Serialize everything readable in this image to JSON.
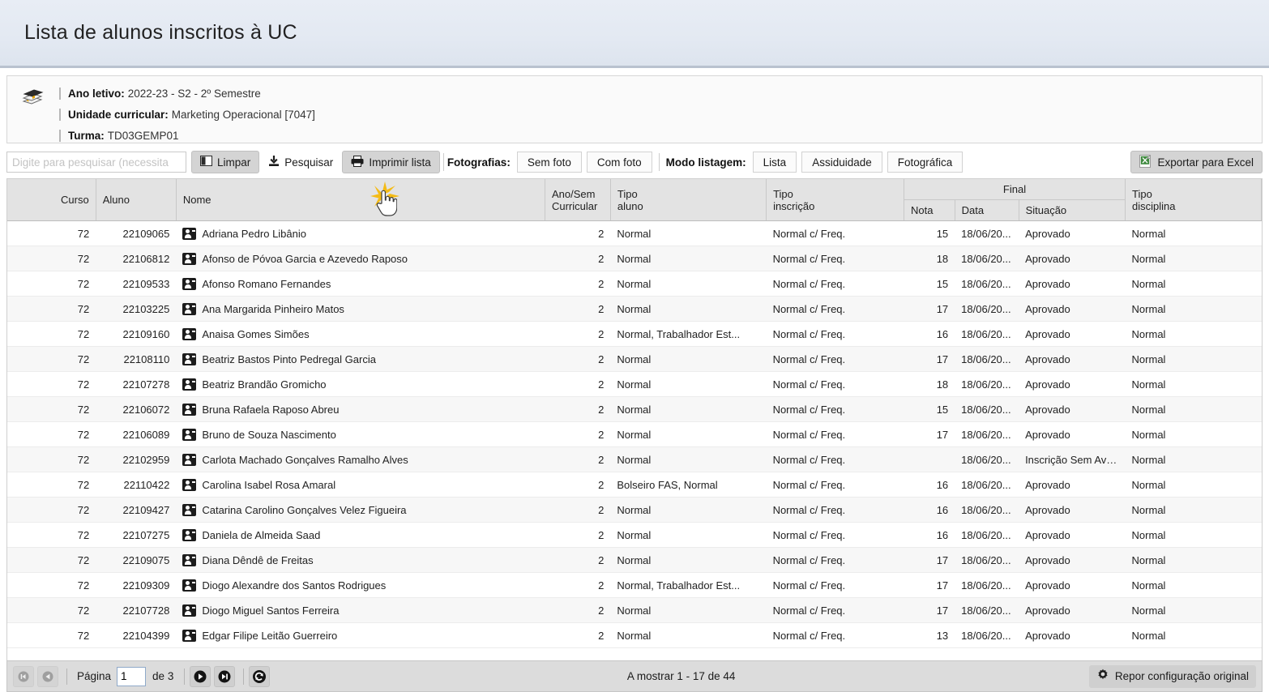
{
  "page": {
    "title": "Lista de alunos inscritos à UC"
  },
  "info": {
    "icon": "books-icon",
    "rows": [
      {
        "label": "Ano letivo:",
        "value": "2022-23 - S2 - 2º Semestre"
      },
      {
        "label": "Unidade curricular:",
        "value": "Marketing Operacional [7047]"
      },
      {
        "label": "Turma:",
        "value": "TD03GEMP01"
      }
    ]
  },
  "toolbar": {
    "search_placeholder": "Digite para pesquisar (necessita",
    "search_value": "",
    "clear_label": "Limpar",
    "search_label": "Pesquisar",
    "print_label": "Imprimir lista",
    "photos_group_label": "Fotografias:",
    "photos_options": [
      "Sem foto",
      "Com foto"
    ],
    "listing_group_label": "Modo listagem:",
    "listing_options": [
      "Lista",
      "Assiduidade",
      "Fotográfica"
    ],
    "export_label": "Exportar para Excel"
  },
  "table": {
    "headers": {
      "curso": "Curso",
      "aluno": "Aluno",
      "nome": "Nome",
      "ano_sem_l1": "Ano/Sem",
      "ano_sem_l2": "Curricular",
      "tipo_aluno_l1": "Tipo",
      "tipo_aluno_l2": "aluno",
      "tipo_inscricao_l1": "Tipo",
      "tipo_inscricao_l2": "inscrição",
      "final_group": "Final",
      "nota": "Nota",
      "data": "Data",
      "situacao": "Situação",
      "tipo_disciplina_l1": "Tipo",
      "tipo_disciplina_l2": "disciplina"
    },
    "rows": [
      {
        "curso": "72",
        "aluno": "22109065",
        "nome": "Adriana Pedro Libânio",
        "ano_sem": "2",
        "tipo_aluno": "Normal",
        "tipo_inscricao": "Normal c/ Freq.",
        "nota": "15",
        "data": "18/06/20...",
        "situacao": "Aprovado",
        "tipo_disciplina": "Normal"
      },
      {
        "curso": "72",
        "aluno": "22106812",
        "nome": "Afonso de Póvoa Garcia e Azevedo Raposo",
        "ano_sem": "2",
        "tipo_aluno": "Normal",
        "tipo_inscricao": "Normal c/ Freq.",
        "nota": "18",
        "data": "18/06/20...",
        "situacao": "Aprovado",
        "tipo_disciplina": "Normal"
      },
      {
        "curso": "72",
        "aluno": "22109533",
        "nome": "Afonso Romano Fernandes",
        "ano_sem": "2",
        "tipo_aluno": "Normal",
        "tipo_inscricao": "Normal c/ Freq.",
        "nota": "15",
        "data": "18/06/20...",
        "situacao": "Aprovado",
        "tipo_disciplina": "Normal"
      },
      {
        "curso": "72",
        "aluno": "22103225",
        "nome": "Ana Margarida Pinheiro Matos",
        "ano_sem": "2",
        "tipo_aluno": "Normal",
        "tipo_inscricao": "Normal c/ Freq.",
        "nota": "17",
        "data": "18/06/20...",
        "situacao": "Aprovado",
        "tipo_disciplina": "Normal"
      },
      {
        "curso": "72",
        "aluno": "22109160",
        "nome": "Anaisa Gomes Simões",
        "ano_sem": "2",
        "tipo_aluno": "Normal, Trabalhador Est...",
        "tipo_inscricao": "Normal c/ Freq.",
        "nota": "16",
        "data": "18/06/20...",
        "situacao": "Aprovado",
        "tipo_disciplina": "Normal"
      },
      {
        "curso": "72",
        "aluno": "22108110",
        "nome": "Beatriz Bastos Pinto Pedregal Garcia",
        "ano_sem": "2",
        "tipo_aluno": "Normal",
        "tipo_inscricao": "Normal c/ Freq.",
        "nota": "17",
        "data": "18/06/20...",
        "situacao": "Aprovado",
        "tipo_disciplina": "Normal"
      },
      {
        "curso": "72",
        "aluno": "22107278",
        "nome": "Beatriz Brandão Gromicho",
        "ano_sem": "2",
        "tipo_aluno": "Normal",
        "tipo_inscricao": "Normal c/ Freq.",
        "nota": "18",
        "data": "18/06/20...",
        "situacao": "Aprovado",
        "tipo_disciplina": "Normal"
      },
      {
        "curso": "72",
        "aluno": "22106072",
        "nome": "Bruna Rafaela Raposo Abreu",
        "ano_sem": "2",
        "tipo_aluno": "Normal",
        "tipo_inscricao": "Normal c/ Freq.",
        "nota": "15",
        "data": "18/06/20...",
        "situacao": "Aprovado",
        "tipo_disciplina": "Normal"
      },
      {
        "curso": "72",
        "aluno": "22106089",
        "nome": "Bruno de Souza Nascimento",
        "ano_sem": "2",
        "tipo_aluno": "Normal",
        "tipo_inscricao": "Normal c/ Freq.",
        "nota": "17",
        "data": "18/06/20...",
        "situacao": "Aprovado",
        "tipo_disciplina": "Normal"
      },
      {
        "curso": "72",
        "aluno": "22102959",
        "nome": "Carlota Machado Gonçalves Ramalho Alves",
        "ano_sem": "2",
        "tipo_aluno": "Normal",
        "tipo_inscricao": "Normal c/ Freq.",
        "nota": "",
        "data": "18/06/20...",
        "situacao": "Inscrição Sem Avali...",
        "tipo_disciplina": "Normal"
      },
      {
        "curso": "72",
        "aluno": "22110422",
        "nome": "Carolina Isabel Rosa Amaral",
        "ano_sem": "2",
        "tipo_aluno": "Bolseiro FAS, Normal",
        "tipo_inscricao": "Normal c/ Freq.",
        "nota": "16",
        "data": "18/06/20...",
        "situacao": "Aprovado",
        "tipo_disciplina": "Normal"
      },
      {
        "curso": "72",
        "aluno": "22109427",
        "nome": "Catarina Carolino Gonçalves Velez Figueira",
        "ano_sem": "2",
        "tipo_aluno": "Normal",
        "tipo_inscricao": "Normal c/ Freq.",
        "nota": "16",
        "data": "18/06/20...",
        "situacao": "Aprovado",
        "tipo_disciplina": "Normal"
      },
      {
        "curso": "72",
        "aluno": "22107275",
        "nome": "Daniela de Almeida Saad",
        "ano_sem": "2",
        "tipo_aluno": "Normal",
        "tipo_inscricao": "Normal c/ Freq.",
        "nota": "16",
        "data": "18/06/20...",
        "situacao": "Aprovado",
        "tipo_disciplina": "Normal"
      },
      {
        "curso": "72",
        "aluno": "22109075",
        "nome": "Diana Dêndê de Freitas",
        "ano_sem": "2",
        "tipo_aluno": "Normal",
        "tipo_inscricao": "Normal c/ Freq.",
        "nota": "17",
        "data": "18/06/20...",
        "situacao": "Aprovado",
        "tipo_disciplina": "Normal"
      },
      {
        "curso": "72",
        "aluno": "22109309",
        "nome": "Diogo Alexandre dos Santos Rodrigues",
        "ano_sem": "2",
        "tipo_aluno": "Normal, Trabalhador Est...",
        "tipo_inscricao": "Normal c/ Freq.",
        "nota": "17",
        "data": "18/06/20...",
        "situacao": "Aprovado",
        "tipo_disciplina": "Normal"
      },
      {
        "curso": "72",
        "aluno": "22107728",
        "nome": "Diogo Miguel Santos Ferreira",
        "ano_sem": "2",
        "tipo_aluno": "Normal",
        "tipo_inscricao": "Normal c/ Freq.",
        "nota": "17",
        "data": "18/06/20...",
        "situacao": "Aprovado",
        "tipo_disciplina": "Normal"
      },
      {
        "curso": "72",
        "aluno": "22104399",
        "nome": "Edgar Filipe Leitão Guerreiro",
        "ano_sem": "2",
        "tipo_aluno": "Normal",
        "tipo_inscricao": "Normal c/ Freq.",
        "nota": "13",
        "data": "18/06/20...",
        "situacao": "Aprovado",
        "tipo_disciplina": "Normal"
      }
    ]
  },
  "pager": {
    "page_label": "Página",
    "page_value": "1",
    "of_label": "de 3",
    "showing": "A mostrar 1 - 17 de 44",
    "reset_label": "Repor configuração original"
  },
  "colors": {
    "title_bg": "#e6ebf3",
    "toolbar_btn": "#d4d4d4",
    "header_bg": "#e3e3e3",
    "pager_bg": "#dcdcdc",
    "excel_green": "#3f8a3f",
    "burst_yellow": "#f4bb16"
  }
}
